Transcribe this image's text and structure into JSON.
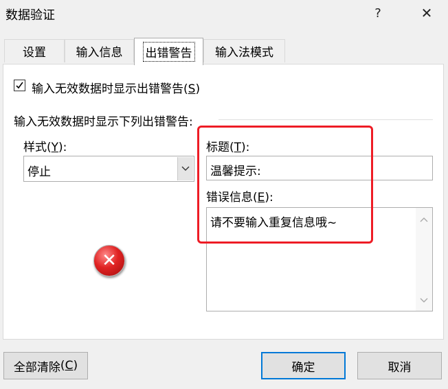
{
  "window": {
    "title": "数据验证",
    "help_glyph": "?",
    "close_glyph": "✕"
  },
  "tabs": [
    {
      "label": "设置"
    },
    {
      "label": "输入信息"
    },
    {
      "label": "出错警告",
      "active": true
    },
    {
      "label": "输入法模式"
    }
  ],
  "alert": {
    "checkbox_label": "输入无效数据时显示出错警告",
    "checkbox_hotkey": "S",
    "checkbox_checked": true,
    "section_label": "输入无效数据时显示下列出错警告:",
    "style_label": "样式",
    "style_hotkey": "Y",
    "style_value": "停止",
    "title_label": "标题",
    "title_hotkey": "T",
    "title_value": "温馨提示:",
    "message_label": "错误信息",
    "message_hotkey": "E",
    "message_value": "请不要输入重复信息哦~",
    "icon": "error-stop-icon"
  },
  "buttons": {
    "clear_label": "全部清除",
    "clear_hotkey": "C",
    "ok_label": "确定",
    "cancel_label": "取消"
  },
  "colors": {
    "highlight": "#ee1c25",
    "default_button_border": "#0078d7"
  }
}
